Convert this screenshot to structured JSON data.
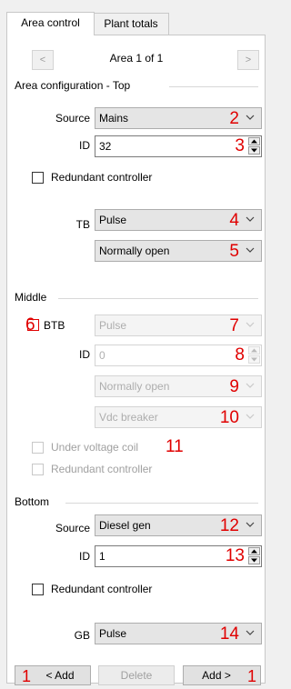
{
  "tabs": [
    {
      "label": "Area control"
    },
    {
      "label": "Plant totals"
    }
  ],
  "nav": {
    "prev": "<",
    "next": ">",
    "label": "Area 1 of 1"
  },
  "top": {
    "title": "Area configuration - Top",
    "source_label": "Source",
    "source_value": "Mains",
    "source_num": "2",
    "id_label": "ID",
    "id_value": "32",
    "id_num": "3",
    "redundant_label": "Redundant controller",
    "tb_label": "TB",
    "tb_value": "Pulse",
    "tb_num": "4",
    "tb_mode_value": "Normally open",
    "tb_mode_num": "5"
  },
  "middle": {
    "title": "Middle",
    "btb_num": "6",
    "btb_label": "BTB",
    "btb_value": "Pulse",
    "btb_value_num": "7",
    "id_label": "ID",
    "id_value": "0",
    "id_num": "8",
    "mode_value": "Normally open",
    "mode_num": "9",
    "breaker_value": "Vdc breaker",
    "breaker_num": "10",
    "uv_label": "Under voltage coil",
    "uv_num": "11",
    "redundant_label": "Redundant controller"
  },
  "bottom": {
    "title": "Bottom",
    "source_label": "Source",
    "source_value": "Diesel gen",
    "source_num": "12",
    "id_label": "ID",
    "id_value": "1",
    "id_num": "13",
    "redundant_label": "Redundant controller",
    "gb_label": "GB",
    "gb_value": "Pulse",
    "gb_num": "14"
  },
  "footer": {
    "add_before_num": "1",
    "add_before_label": "< Add",
    "delete_label": "Delete",
    "add_after_label": "Add >",
    "add_after_num": "1"
  },
  "colors": {
    "annotation": "#e00000",
    "window": "#f0f0f0",
    "panel": "#ffffff"
  }
}
